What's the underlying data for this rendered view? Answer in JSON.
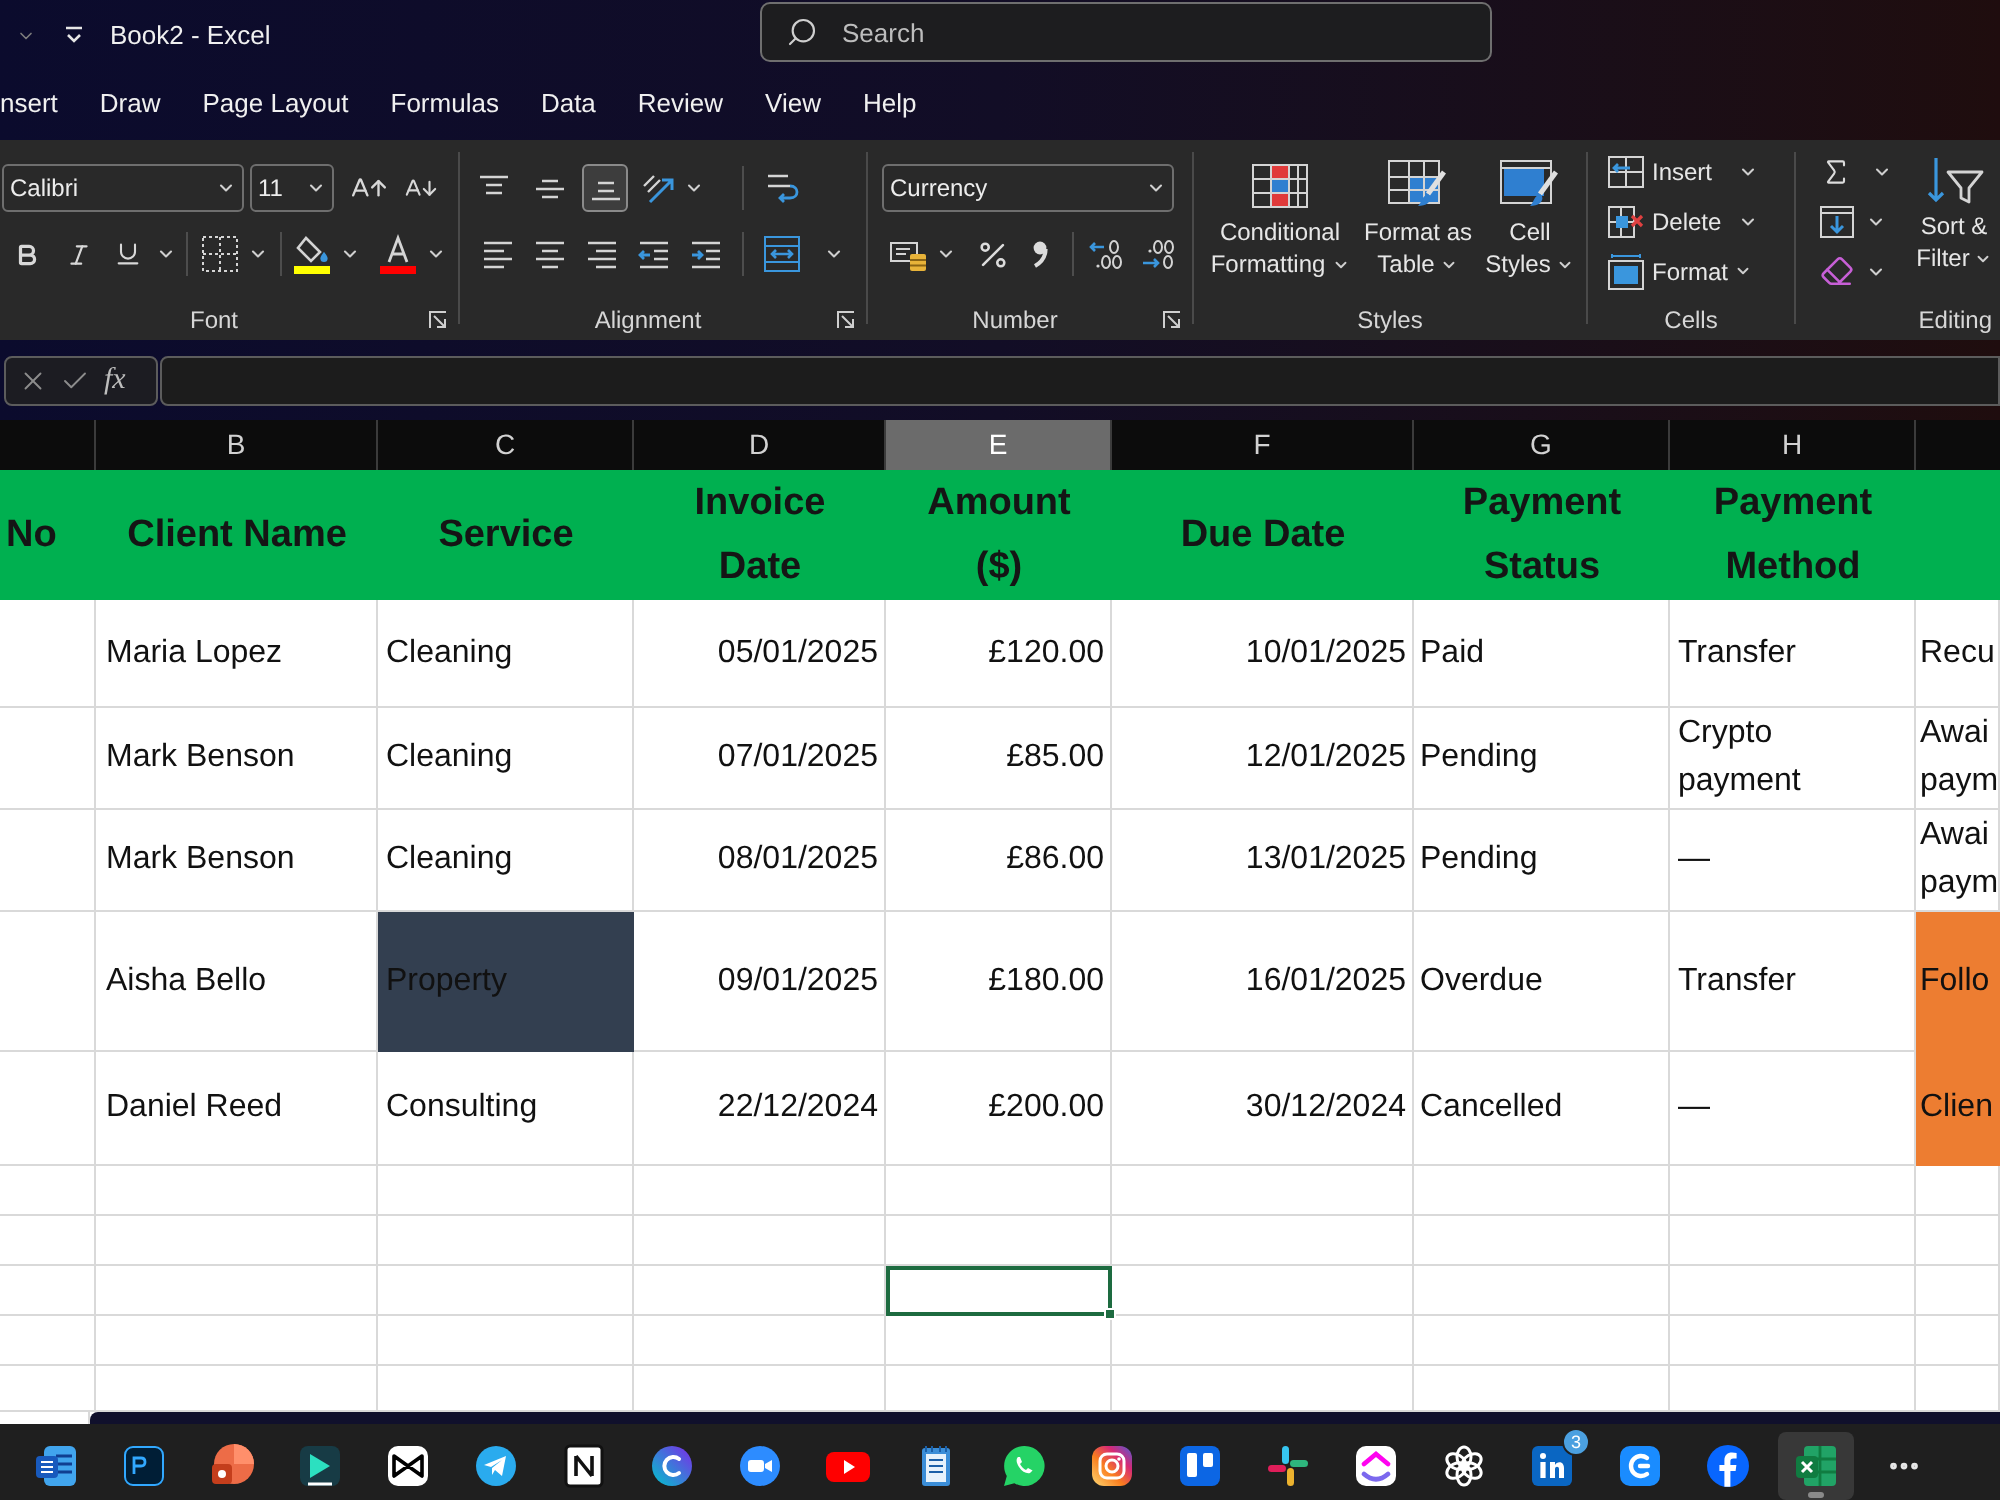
{
  "title_bar": {
    "title": "Book2 - Excel",
    "search": {
      "placeholder": "Search"
    }
  },
  "ribbon_tabs": [
    {
      "label": "nsert",
      "selected": false
    },
    {
      "label": "Draw",
      "selected": false
    },
    {
      "label": "Page Layout",
      "selected": false
    },
    {
      "label": "Formulas",
      "selected": false
    },
    {
      "label": "Data",
      "selected": false
    },
    {
      "label": "Review",
      "selected": false
    },
    {
      "label": "View",
      "selected": false
    },
    {
      "label": "Help",
      "selected": false
    }
  ],
  "ribbon": {
    "font": {
      "label": "Font",
      "font_name": "Calibri",
      "font_size": "11"
    },
    "alignment": {
      "label": "Alignment",
      "vertical_align": [
        {
          "kind": "top",
          "selected": false
        },
        {
          "kind": "middle",
          "selected": false
        },
        {
          "kind": "bottom",
          "selected": true
        }
      ]
    },
    "number": {
      "label": "Number",
      "format": "Currency"
    },
    "styles": {
      "label": "Styles",
      "buttons": [
        {
          "kind": "conditional",
          "label": "Conditional Formatting"
        },
        {
          "kind": "table",
          "label": "Format as Table"
        },
        {
          "kind": "cell",
          "label": "Cell Styles"
        }
      ]
    },
    "cells": {
      "label": "Cells",
      "buttons": [
        {
          "kind": "insert",
          "label": "Insert"
        },
        {
          "kind": "delete",
          "label": "Delete"
        },
        {
          "kind": "format",
          "label": "Format"
        }
      ]
    },
    "editing": {
      "label": "Editing",
      "sort_filter": "Sort & Filter"
    }
  },
  "formula_bar": {
    "function_label": "fx"
  },
  "sheet": {
    "column_headers": [
      {
        "letter": "B",
        "selected": false
      },
      {
        "letter": "C",
        "selected": false
      },
      {
        "letter": "D",
        "selected": false
      },
      {
        "letter": "E",
        "selected": true
      },
      {
        "letter": "F",
        "selected": false
      },
      {
        "letter": "G",
        "selected": false
      },
      {
        "letter": "H",
        "selected": false
      }
    ],
    "header_row": [
      "No",
      "Client Name",
      "Service",
      "Invoice Date",
      "Amount ($)",
      "Due Date",
      "Payment Status",
      "Payment Method"
    ],
    "rows": [
      {
        "cells": [
          {
            "text": "Maria Lopez"
          },
          {
            "text": "Cleaning"
          },
          {
            "text": "05/01/2025"
          },
          {
            "text": "£120.00"
          },
          {
            "text": "10/01/2025"
          },
          {
            "text": "Paid"
          },
          {
            "text": "Transfer"
          },
          {
            "text": "Recu"
          }
        ]
      },
      {
        "cells": [
          {
            "text": "Mark Benson"
          },
          {
            "text": "Cleaning"
          },
          {
            "text": "07/01/2025"
          },
          {
            "text": "£85.00"
          },
          {
            "text": "12/01/2025"
          },
          {
            "text": "Pending"
          },
          {
            "text": "Crypto payment"
          },
          {
            "text": "Awai paym"
          }
        ]
      },
      {
        "cells": [
          {
            "text": "Mark Benson"
          },
          {
            "text": "Cleaning"
          },
          {
            "text": "08/01/2025"
          },
          {
            "text": "£86.00"
          },
          {
            "text": "13/01/2025"
          },
          {
            "text": "Pending"
          },
          {
            "text": "—"
          },
          {
            "text": "Awai paym"
          }
        ]
      },
      {
        "cells": [
          {
            "text": "Aisha Bello"
          },
          {
            "text": "Property",
            "color": "#333f50"
          },
          {
            "text": "09/01/2025"
          },
          {
            "text": "£180.00"
          },
          {
            "text": "16/01/2025"
          },
          {
            "text": "Overdue"
          },
          {
            "text": "Transfer"
          },
          {
            "text": "Follo",
            "color": "#ed7d31"
          }
        ]
      },
      {
        "cells": [
          {
            "text": "Daniel Reed"
          },
          {
            "text": "Consulting"
          },
          {
            "text": "22/12/2024"
          },
          {
            "text": "£200.00"
          },
          {
            "text": "30/12/2024"
          },
          {
            "text": "Cancelled"
          },
          {
            "text": "—"
          },
          {
            "text": "Clien",
            "color": "#ed7d31"
          }
        ]
      }
    ],
    "blank_rows": [
      {
        "selected": false
      },
      {
        "selected": false
      },
      {
        "selected": true
      },
      {
        "selected": false
      },
      {
        "selected": false
      }
    ]
  },
  "taskbar": {
    "apps": [
      {
        "kind": "doc",
        "active": false
      },
      {
        "kind": "ps",
        "active": false
      },
      {
        "kind": "slides",
        "active": false
      },
      {
        "kind": "film",
        "active": false
      },
      {
        "kind": "cut",
        "active": false
      },
      {
        "kind": "plane",
        "active": false
      },
      {
        "kind": "notebook",
        "active": false
      },
      {
        "kind": "ring",
        "active": false
      },
      {
        "kind": "meet",
        "active": false
      },
      {
        "kind": "play",
        "active": false
      },
      {
        "kind": "notepad",
        "active": false
      },
      {
        "kind": "chat",
        "active": false
      },
      {
        "kind": "camera",
        "active": false
      },
      {
        "kind": "board",
        "active": false
      },
      {
        "kind": "pinwheel",
        "active": false
      },
      {
        "kind": "chevron",
        "active": false
      },
      {
        "kind": "knot",
        "active": false
      },
      {
        "kind": "square",
        "active": false,
        "badge": "3"
      },
      {
        "kind": "arrow",
        "active": false
      },
      {
        "kind": "fb",
        "active": false
      },
      {
        "kind": "sheet",
        "active": true
      }
    ]
  }
}
